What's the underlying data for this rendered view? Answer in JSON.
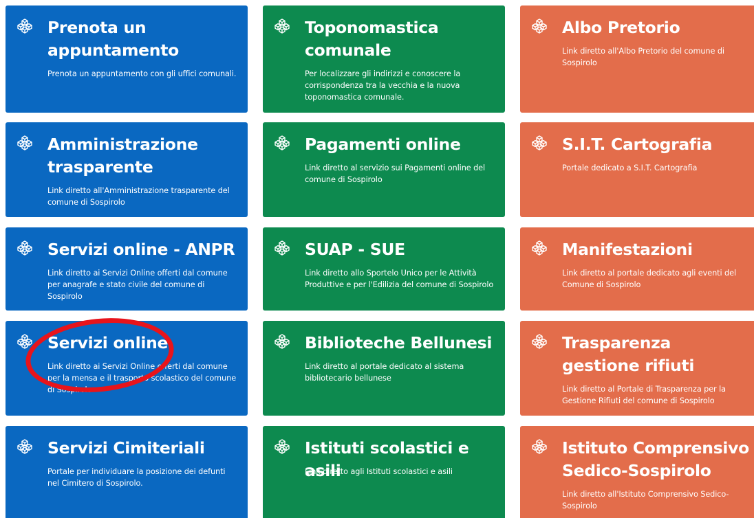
{
  "cards": [
    {
      "title": "Prenota un appuntamento",
      "description": "Prenota un appuntamento con gli uffici comunali.",
      "color": "#0a68c1",
      "icon": "cube-icon"
    },
    {
      "title": "Toponomastica comunale",
      "description": "Per localizzare gli indirizzi e conoscere la corrispondenza tra la vecchia e la nuova toponomastica comunale.",
      "color": "#0d8a4f",
      "icon": "cube-icon"
    },
    {
      "title": "Albo Pretorio",
      "description": "Link diretto all'Albo Pretorio del comune di Sospirolo",
      "color": "#e36d4b",
      "icon": "cube-icon"
    },
    {
      "title": "Amministrazione trasparente",
      "description": "Link diretto all'Amministrazione trasparente del comune di Sospirolo",
      "color": "#0a68c1",
      "icon": "cube-icon"
    },
    {
      "title": "Pagamenti online",
      "description": "Link diretto al servizio sui Pagamenti online del comune di Sospirolo",
      "color": "#0d8a4f",
      "icon": "cube-icon"
    },
    {
      "title": "S.I.T. Cartografia",
      "description": "Portale dedicato a S.I.T. Cartografia",
      "color": "#e36d4b",
      "icon": "cube-icon"
    },
    {
      "title": "Servizi online - ANPR",
      "description": "Link diretto ai Servizi Online offerti dal comune per anagrafe e stato civile del comune di Sospirolo",
      "color": "#0a68c1",
      "icon": "cube-icon"
    },
    {
      "title": "SUAP - SUE",
      "description": "Link diretto allo Sportelo Unico per le Attività Produttive e per l'Edilizia del comune di Sospirolo",
      "color": "#0d8a4f",
      "icon": "cube-icon"
    },
    {
      "title": "Manifestazioni",
      "description": "Link diretto al portale dedicato agli eventi del Comune di Sospirolo",
      "color": "#e36d4b",
      "icon": "cube-icon"
    },
    {
      "title": "Servizi online",
      "description": "Link diretto ai Servizi Online offerti dal comune per la mensa e il trasporto scolastico del comune di Sospirolo",
      "color": "#0a68c1",
      "icon": "cube-icon"
    },
    {
      "title": "Biblioteche Bellunesi",
      "description": "Link diretto al portale dedicato al sistema bibliotecario bellunese",
      "color": "#0d8a4f",
      "icon": "cube-icon"
    },
    {
      "title": "Trasparenza gestione rifiuti",
      "description": "Link diretto al Portale di Trasparenza per la Gestione Rifiuti del comune di Sospirolo",
      "color": "#e36d4b",
      "icon": "cube-icon"
    },
    {
      "title": "Servizi Cimiteriali",
      "description": "Portale per individuare la posizione dei defunti nel Cimitero di Sospirolo.",
      "color": "#0a68c1",
      "icon": "cube-icon"
    },
    {
      "title": "Istituti scolastici e asili",
      "description": "Link diretto agli Istituti scolastici e asili",
      "color": "#0d8a4f",
      "icon": "cube-icon"
    },
    {
      "title": "Istituto Comprensivo Sedico-Sospirolo",
      "description": "Link diretto all'Istituto Comprensivo Sedico-Sospirolo",
      "color": "#e36d4b",
      "icon": "cube-icon"
    }
  ],
  "annotation": {
    "color": "#e8141b",
    "target": "Servizi online",
    "shape": "ellipse"
  }
}
